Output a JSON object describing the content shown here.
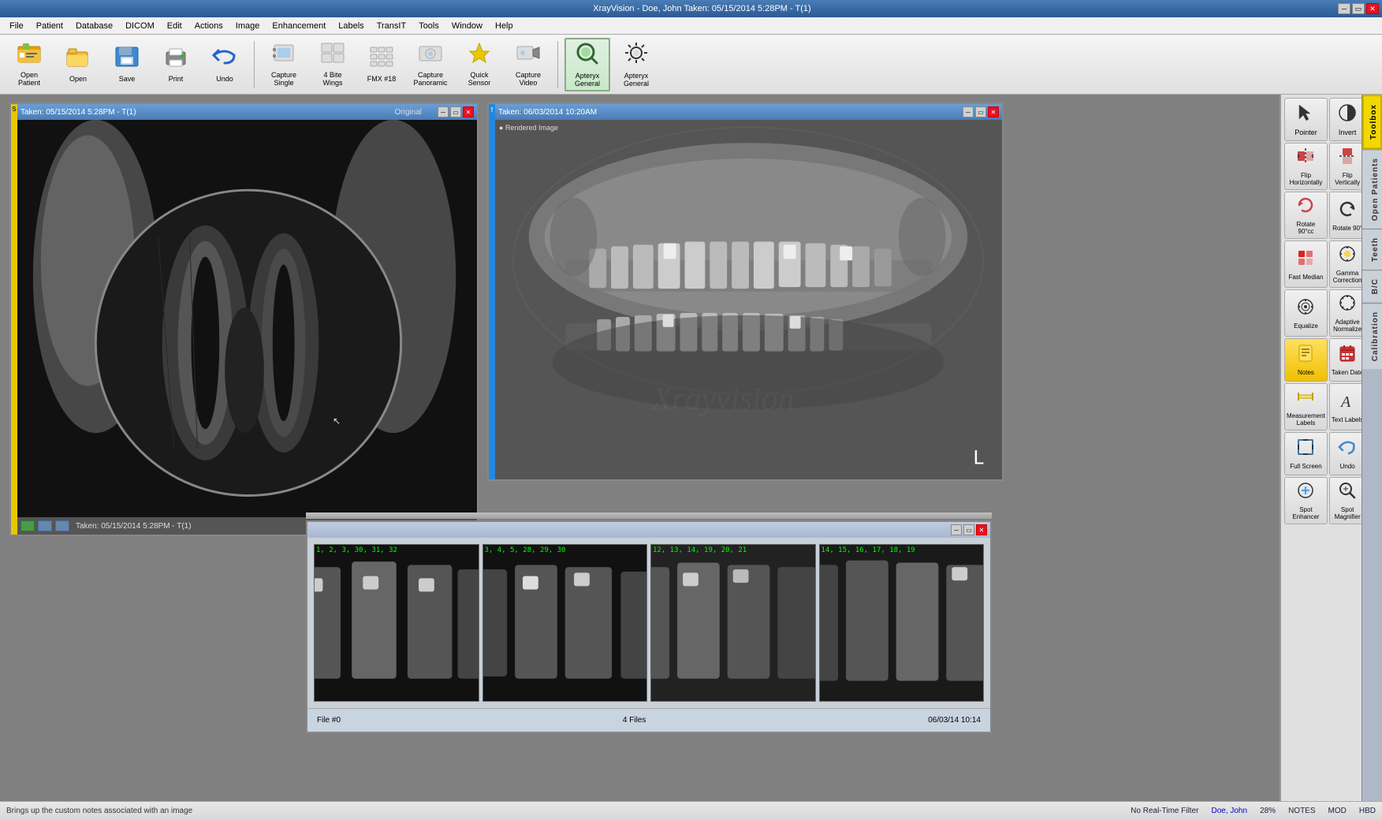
{
  "window": {
    "title": "XrayVision - Doe, John  Taken: 05/15/2014  5:28PM - T(1)",
    "controls": [
      "minimize",
      "restore",
      "close"
    ]
  },
  "menu": {
    "items": [
      "File",
      "Patient",
      "Database",
      "DICOM",
      "Edit",
      "Actions",
      "Image",
      "Enhancement",
      "Labels",
      "TransIT",
      "Tools",
      "Window",
      "Help"
    ]
  },
  "toolbar": {
    "buttons": [
      {
        "id": "open-patient",
        "icon": "📂",
        "label": "Open\nPatient"
      },
      {
        "id": "open",
        "icon": "📁",
        "label": "Open"
      },
      {
        "id": "save",
        "icon": "💾",
        "label": "Save"
      },
      {
        "id": "print",
        "icon": "🖨",
        "label": "Print"
      },
      {
        "id": "undo",
        "icon": "↩",
        "label": "Undo"
      },
      {
        "id": "capture-single",
        "icon": "⬜",
        "label": "Capture\nSingle"
      },
      {
        "id": "4-bite-wings",
        "icon": "⬛",
        "label": "4 Bite Wings"
      },
      {
        "id": "fmx-18",
        "icon": "⬛",
        "label": "FMX #18"
      },
      {
        "id": "capture-panoramic",
        "icon": "👤",
        "label": "Capture\nPanoramic"
      },
      {
        "id": "quick-sensor",
        "icon": "⚡",
        "label": "Quick\nSensor"
      },
      {
        "id": "capture-video",
        "icon": "🎥",
        "label": "Capture\nVideo"
      },
      {
        "id": "apteryx-general-1",
        "icon": "🔍",
        "label": "Apteryx\nGeneral"
      },
      {
        "id": "apteryx-general-2",
        "icon": "✳",
        "label": "Apteryx\nGeneral"
      }
    ]
  },
  "xray_window_1": {
    "title": "Taken: 05/15/2014  5:28PM - T(1)",
    "badge": "Original",
    "type": "periapical",
    "indicator": "yellow"
  },
  "xray_window_2": {
    "title": "Taken: 06/03/2014  10:20AM",
    "type": "panoramic",
    "indicator": "blue",
    "watermark": "Xrayvision"
  },
  "thumbnail_panel": {
    "file_info": "File #0",
    "files_count": "4 Files",
    "date": "06/03/14  10:14",
    "thumbnails": [
      {
        "label": "1, 2, 3, 30, 31, 32"
      },
      {
        "label": "3, 4, 5, 28, 29, 30"
      },
      {
        "label": "12, 13, 14, 19, 20, 21"
      },
      {
        "label": "14, 15, 16, 17, 18, 19"
      }
    ]
  },
  "toolbox": {
    "tabs": [
      "Toolbox",
      "Open Patients",
      "Teeth",
      "B/C",
      "Calibration"
    ],
    "buttons": [
      {
        "id": "pointer",
        "icon": "↖",
        "label": "Pointer"
      },
      {
        "id": "invert",
        "icon": "◑",
        "label": "Invert"
      },
      {
        "id": "flip-h",
        "icon": "↔",
        "label": "Flip\nHorizontally"
      },
      {
        "id": "flip-v",
        "icon": "↕",
        "label": "Flip\nVertically"
      },
      {
        "id": "rotate-ccw",
        "icon": "↺",
        "label": "Rotate\n90°cc"
      },
      {
        "id": "rotate-cw",
        "icon": "↻",
        "label": "Rotate 90°"
      },
      {
        "id": "fast-median",
        "icon": "◈",
        "label": "Fast Median"
      },
      {
        "id": "gamma-correction",
        "icon": "☀",
        "label": "Gamma\nCorrection"
      },
      {
        "id": "equalize",
        "icon": "☀",
        "label": "Equalize"
      },
      {
        "id": "adaptive-normalize",
        "icon": "☀",
        "label": "Adaptive\nNormalize"
      },
      {
        "id": "notes",
        "icon": "📋",
        "label": "Notes"
      },
      {
        "id": "taken-date",
        "icon": "📅",
        "label": "Taken Date"
      },
      {
        "id": "measurement-labels",
        "icon": "📏",
        "label": "Measurement\nLabels"
      },
      {
        "id": "text-labels",
        "icon": "A",
        "label": "Text Labels"
      },
      {
        "id": "full-screen",
        "icon": "⛶",
        "label": "Full Screen"
      },
      {
        "id": "undo",
        "icon": "↩",
        "label": "Undo"
      },
      {
        "id": "spot-enhancer",
        "icon": "⊕",
        "label": "Spot\nEnhancer"
      },
      {
        "id": "spot-magnifier",
        "icon": "🔍",
        "label": "Spot\nMagnifier"
      }
    ]
  },
  "status_bar": {
    "message": "Brings up the custom notes associated with an image",
    "filter": "No Real-Time Filter",
    "patient_link": "Doe, John",
    "zoom": "28%",
    "notes": "NOTES",
    "mod": "MOD",
    "hbd": "HBD"
  }
}
